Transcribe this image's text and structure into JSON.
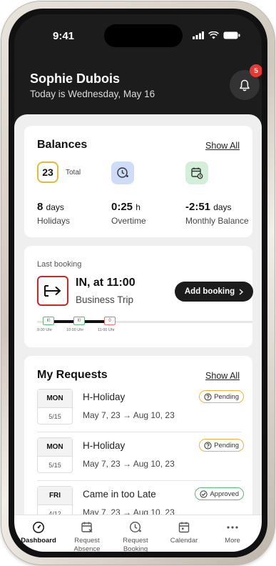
{
  "status_bar": {
    "time": "9:41"
  },
  "header": {
    "name": "Sophie Dubois",
    "date_text": "Today is Wednesday, May 16",
    "notification_count": "5"
  },
  "balances": {
    "title": "Balances",
    "show_all": "Show All",
    "total_value": "23",
    "total_label": "Total",
    "items": [
      {
        "value": "8",
        "unit": "days",
        "label": "Holidays"
      },
      {
        "value": "0:25",
        "unit": "h",
        "label": "Overtime"
      },
      {
        "value": "-2:51",
        "unit": "days",
        "label": "Monthly Balance"
      }
    ]
  },
  "last_booking": {
    "label": "Last booking",
    "title": "IN, at 11:00",
    "subtitle": "Business Trip",
    "add_button": "Add booking",
    "timeline": [
      {
        "mark": "I0",
        "time": "9:00 Uhr"
      },
      {
        "mark": "I0",
        "time": "10:00 Uhr"
      },
      {
        "mark": "0",
        "time": "11:00 Uhr"
      }
    ]
  },
  "requests": {
    "title": "My Requests",
    "show_all": "Show All",
    "items": [
      {
        "day": "MON",
        "date": "5/15",
        "type": "H-Holiday",
        "range": "May 7, 23 → Aug 10, 23",
        "status": "Pending"
      },
      {
        "day": "MON",
        "date": "5/15",
        "type": "H-Holiday",
        "range": "May 7, 23 → Aug 10, 23",
        "status": "Pending"
      },
      {
        "day": "FRI",
        "date": "4/12",
        "type": "Came in too Late",
        "range": "May 7, 23 → Aug 10, 23",
        "status": "Approved"
      }
    ]
  },
  "nav": {
    "items": [
      {
        "label": "Dashboard"
      },
      {
        "label": "Request Absence"
      },
      {
        "label": "Request Booking"
      },
      {
        "label": "Calendar"
      },
      {
        "label": "More"
      }
    ]
  },
  "colors": {
    "accent_yellow": "#e4b93c",
    "accent_red": "#c62828",
    "approved_green": "#5cb67a",
    "badge_red": "#e53935"
  }
}
